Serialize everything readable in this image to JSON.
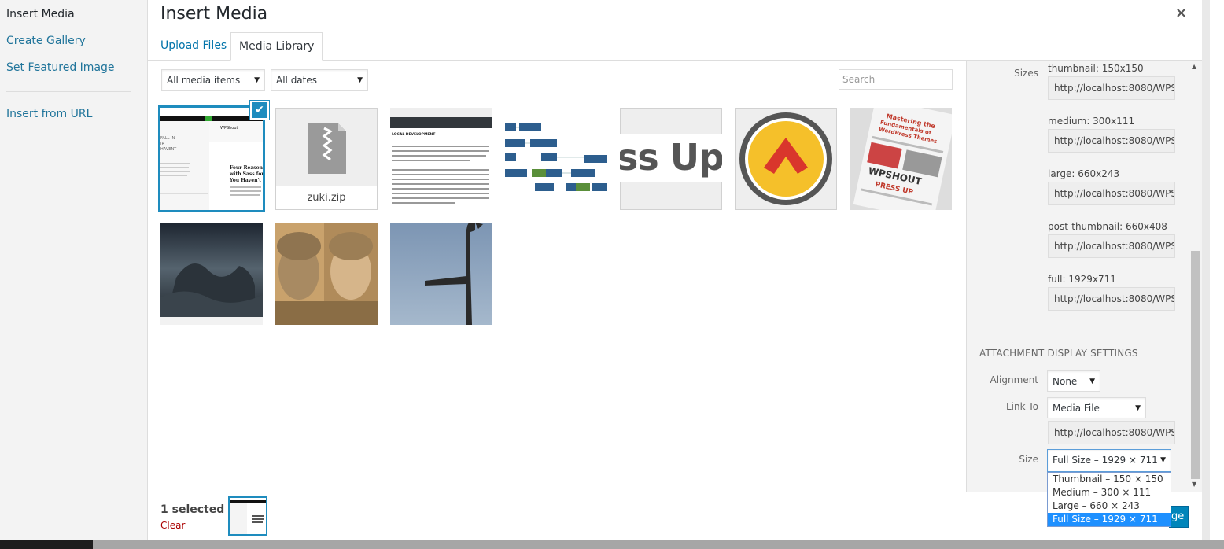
{
  "menu": {
    "items": [
      {
        "label": "Insert Media"
      },
      {
        "label": "Create Gallery"
      },
      {
        "label": "Set Featured Image"
      },
      {
        "label": "Insert from URL"
      }
    ]
  },
  "modal": {
    "title": "Insert Media",
    "close_icon": "×"
  },
  "tabs": [
    {
      "label": "Upload Files"
    },
    {
      "label": "Media Library"
    }
  ],
  "toolbar": {
    "type_filter": "All media items",
    "date_filter": "All dates",
    "search_placeholder": "Search"
  },
  "library": {
    "items": [
      {
        "kind": "image",
        "desc": "Four Reasons screenshot"
      },
      {
        "kind": "file",
        "filename": "zuki.zip"
      },
      {
        "kind": "image",
        "desc": "local development screenshot"
      },
      {
        "kind": "image",
        "desc": "flowchart"
      },
      {
        "kind": "image",
        "text": "ss Up"
      },
      {
        "kind": "image",
        "desc": "logo"
      },
      {
        "kind": "image",
        "desc": "Mastering the Fundamentals of WordPress Themes collage"
      },
      {
        "kind": "image",
        "desc": "dark sea scene"
      },
      {
        "kind": "image",
        "desc": "banknotes"
      },
      {
        "kind": "image",
        "desc": "sky"
      }
    ]
  },
  "sidebar": {
    "sizes_label": "Sizes",
    "sizes": [
      {
        "name": "thumbnail: 150x150",
        "url": "http://localhost:8080/WPS"
      },
      {
        "name": "medium: 300x111",
        "url": "http://localhost:8080/WPS"
      },
      {
        "name": "large: 660x243",
        "url": "http://localhost:8080/WPS"
      },
      {
        "name": "post-thumbnail: 660x408",
        "url": "http://localhost:8080/WPS"
      },
      {
        "name": "full: 1929x711",
        "url": "http://localhost:8080/WPS"
      }
    ],
    "display_settings_heading": "ATTACHMENT DISPLAY SETTINGS",
    "alignment_label": "Alignment",
    "alignment_value": "None",
    "link_to_label": "Link To",
    "link_to_value": "Media File",
    "link_url": "http://localhost:8080/WPS",
    "size_label": "Size",
    "size_value": "Full Size – 1929 × 711",
    "size_options": [
      "Thumbnail – 150 × 150",
      "Medium – 300 × 111",
      "Large – 660 × 243",
      "Full Size – 1929 × 711"
    ]
  },
  "footer": {
    "selected_text": "1 selected",
    "clear_label": "Clear",
    "insert_button_fragment": "ge"
  },
  "colors": {
    "accent": "#1e8cbe",
    "link": "#0073aa",
    "clear": "#a00000",
    "dropdown_highlight": "#1e90ff"
  }
}
